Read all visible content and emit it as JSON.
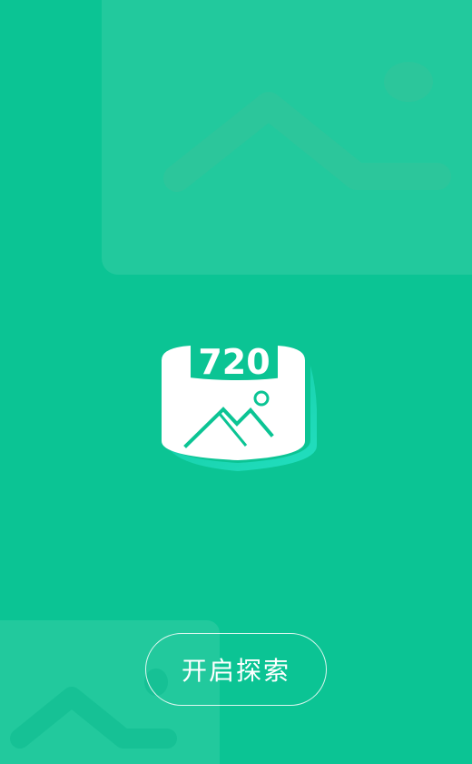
{
  "colors": {
    "background": "#0bc494",
    "panel": "#22c99d",
    "accent_white": "#ffffff",
    "shadow": "#18d8b0"
  },
  "hero": {
    "badge_text": "720",
    "icon": "panorama-720-icon"
  },
  "decorations": {
    "top_icon": "landscape-image-icon",
    "bottom_icon": "landscape-image-icon"
  },
  "actions": {
    "start_label": "开启探索"
  }
}
